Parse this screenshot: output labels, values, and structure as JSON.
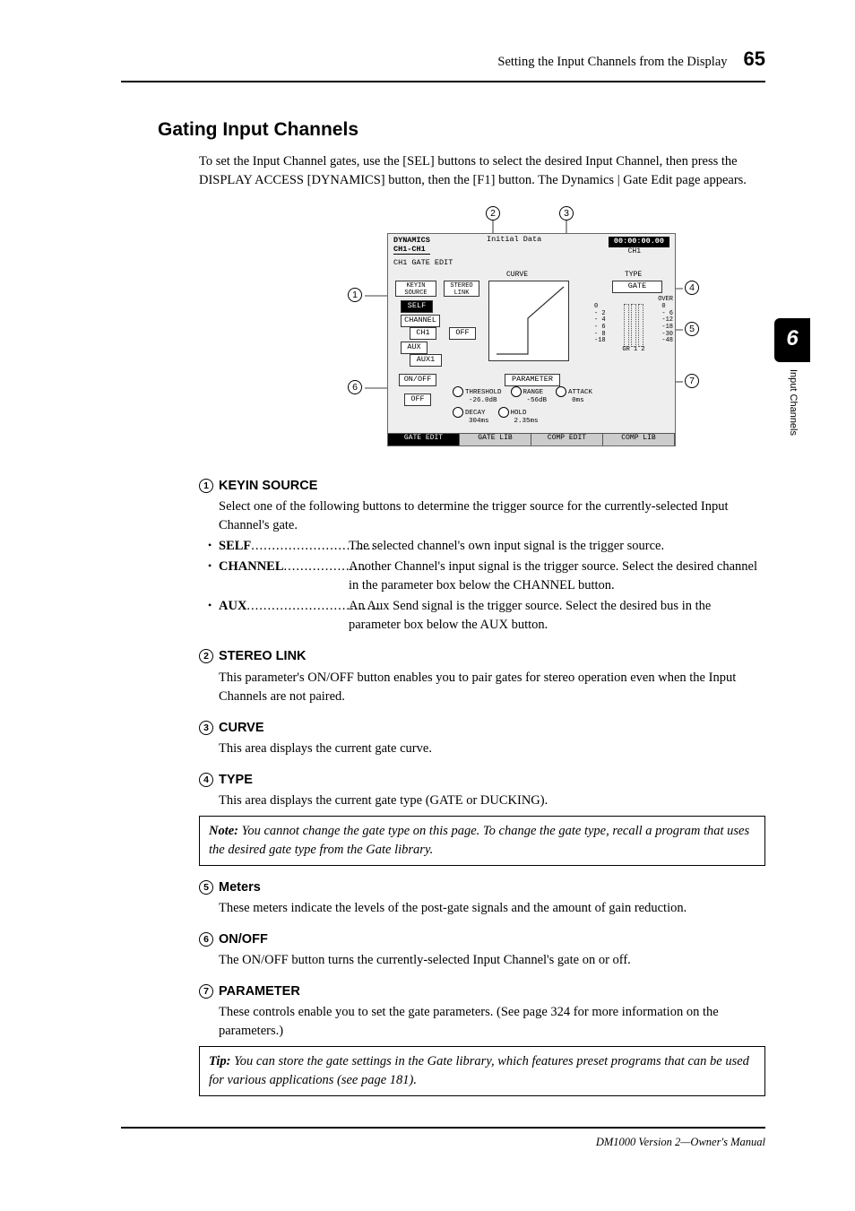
{
  "header": {
    "section_title": "Setting the Input Channels from the Display",
    "page_number": "65"
  },
  "chapter_tab": {
    "number": "6",
    "label": "Input Channels"
  },
  "heading": "Gating Input Channels",
  "intro": "To set the Input Channel gates, use the [SEL] buttons to select the desired Input Channel, then press the DISPLAY ACCESS [DYNAMICS] button, then the [F1] button. The Dynamics | Gate Edit page appears.",
  "figure": {
    "callouts": {
      "c1": "1",
      "c2": "2",
      "c3": "3",
      "c4": "4",
      "c5": "5",
      "c6": "6",
      "c7": "7"
    },
    "screen": {
      "title_line1": "DYNAMICS",
      "title_line2": "CH1-CH1",
      "init": "Initial Data",
      "time": "00:00:00.00",
      "ch_label": "CH1",
      "sub": "CH1 GATE EDIT",
      "keyin_label": "KEYIN SOURCE",
      "stereo_label": "STEREO LINK",
      "curve_label": "CURVE",
      "type_label": "TYPE",
      "type_value": "GATE",
      "self": "SELF",
      "channel": "CHANNEL",
      "ch_box": "CH1",
      "aux": "AUX",
      "aux_box": "AUX1",
      "off": "OFF",
      "onoff_sec": "ON/OFF",
      "param_sec": "PARAMETER",
      "p_threshold_l": "THRESHOLD",
      "p_threshold_v": "-26.0dB",
      "p_range_l": "RANGE",
      "p_range_v": "-56dB",
      "p_attack_l": "ATTACK",
      "p_attack_v": "0ms",
      "p_decay_l": "DECAY",
      "p_decay_v": "304ms",
      "p_hold_l": "HOLD",
      "p_hold_v": "2.35ms",
      "meter_over": "OVER",
      "meter_scale_left": [
        "0",
        "- 2",
        "- 4",
        "- 6",
        "- 8",
        "-18"
      ],
      "meter_scale_right": [
        "0",
        "- 6",
        "-12",
        "-18",
        "-30",
        "-48"
      ],
      "meter_gr": "GR  1  2",
      "tabs": [
        "GATE EDIT",
        "GATE LIB",
        "COMP EDIT",
        "COMP LIB"
      ]
    }
  },
  "sections": {
    "s1": {
      "num": "1",
      "title": "KEYIN SOURCE",
      "body": "Select one of the following buttons to determine the trigger source for the currently-selected Input Channel's gate.",
      "items": [
        {
          "term": "SELF",
          "def": "The selected channel's own input signal is the trigger source."
        },
        {
          "term": "CHANNEL",
          "def": "Another Channel's input signal is the trigger source. Select the desired channel in the parameter box below the CHANNEL button."
        },
        {
          "term": "AUX",
          "def": "An Aux Send signal is the trigger source. Select the desired bus in the parameter box below the AUX button."
        }
      ]
    },
    "s2": {
      "num": "2",
      "title": "STEREO LINK",
      "body": "This parameter's ON/OFF button enables you to pair gates for stereo operation even when the Input Channels are not paired."
    },
    "s3": {
      "num": "3",
      "title": "CURVE",
      "body": "This area displays the current gate curve."
    },
    "s4": {
      "num": "4",
      "title": "TYPE",
      "body": "This area displays the current gate type (GATE or DUCKING).",
      "note_lead": "Note:",
      "note": "You cannot change the gate type on this page. To change the gate type, recall a program that uses the desired gate type from the Gate library."
    },
    "s5": {
      "num": "5",
      "title": "Meters",
      "body": "These meters indicate the levels of the post-gate signals and the amount of gain reduction."
    },
    "s6": {
      "num": "6",
      "title": "ON/OFF",
      "body": "The ON/OFF button turns the currently-selected Input Channel's gate on or off."
    },
    "s7": {
      "num": "7",
      "title": "PARAMETER",
      "body": "These controls enable you to set the gate parameters. (See page 324 for more information on the parameters.)",
      "tip_lead": "Tip:",
      "tip": "You can store the gate settings in the Gate library, which features preset programs that can be used for various applications (see page 181)."
    }
  },
  "footer": "DM1000 Version 2—Owner's Manual"
}
